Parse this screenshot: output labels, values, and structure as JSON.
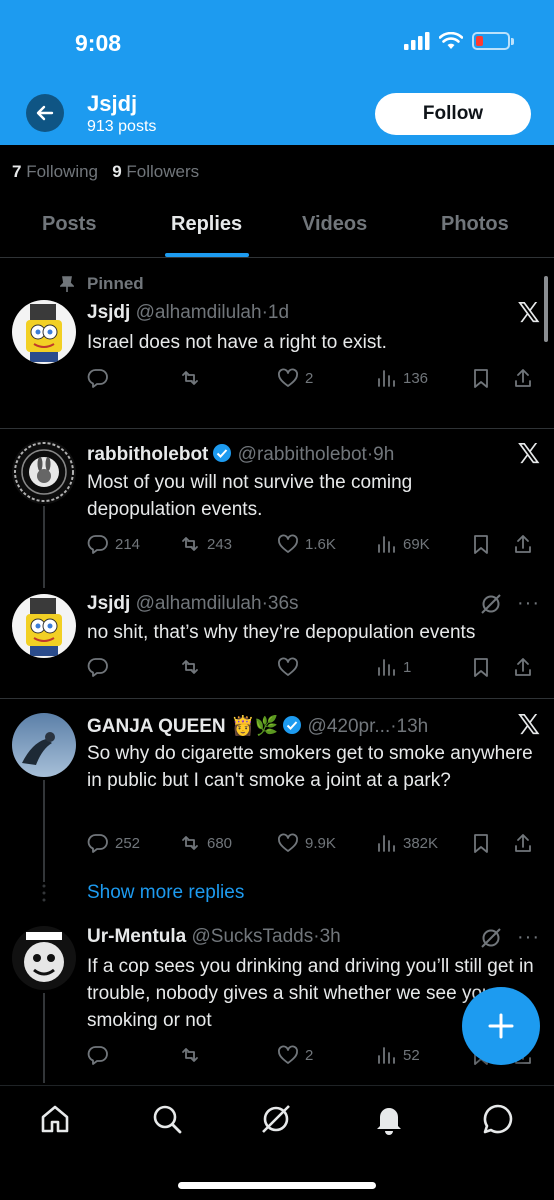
{
  "status_bar": {
    "time": "9:08"
  },
  "header": {
    "name": "Jsjdj",
    "posts": "913 posts",
    "follow_label": "Follow"
  },
  "counts": {
    "following_count": "7",
    "following_label": "Following",
    "followers_count": "9",
    "followers_label": "Followers"
  },
  "tabs": [
    {
      "label": "Posts"
    },
    {
      "label": "Replies"
    },
    {
      "label": "Videos"
    },
    {
      "label": "Photos"
    }
  ],
  "pinned_label": "Pinned",
  "tweets": [
    {
      "name": "Jsjdj",
      "handle": "@alhamdilulah",
      "time": "1d",
      "text": "Israel does not have a right to exist.",
      "replies": "",
      "retweets": "",
      "likes": "2",
      "views": "136"
    },
    {
      "name": "rabbitholebot",
      "handle": "@rabbitholebot",
      "time": "9h",
      "text": "Most of you will not survive the coming depopulation events.",
      "replies": "214",
      "retweets": "243",
      "likes": "1.6K",
      "views": "69K"
    },
    {
      "name": "Jsjdj",
      "handle": "@alhamdilulah",
      "time": "36s",
      "text": "no shit, that’s why they’re depopulation events",
      "replies": "",
      "retweets": "",
      "likes": "",
      "views": "1"
    },
    {
      "name": "GANJA QUEEN",
      "emoji": "👸🌿",
      "handle": "@420pr...",
      "time": "13h",
      "text": "So why do cigarette smokers get to smoke anywhere in public but I can't smoke a joint at a park?",
      "replies": "252",
      "retweets": "680",
      "likes": "9.9K",
      "views": "382K"
    },
    {
      "name": "Ur-Mentula",
      "handle": "@SucksTadds",
      "time": "3h",
      "text": "If a cop sees you drinking and driving you’ll still get in trouble, nobody gives a shit whether we see you smoking or not",
      "replies": "",
      "retweets": "",
      "likes": "2",
      "views": "52"
    }
  ],
  "show_more_label": "Show more replies",
  "more_label": "···",
  "x_logo": "𝕏",
  "separator": "·",
  "colors": {
    "accent": "#1d9bf0",
    "background": "#000000",
    "muted": "#71767b",
    "text": "#e7e9ea"
  },
  "nav_icons": [
    "home-icon",
    "search-icon",
    "grok-icon",
    "notifications-icon",
    "messages-icon"
  ]
}
